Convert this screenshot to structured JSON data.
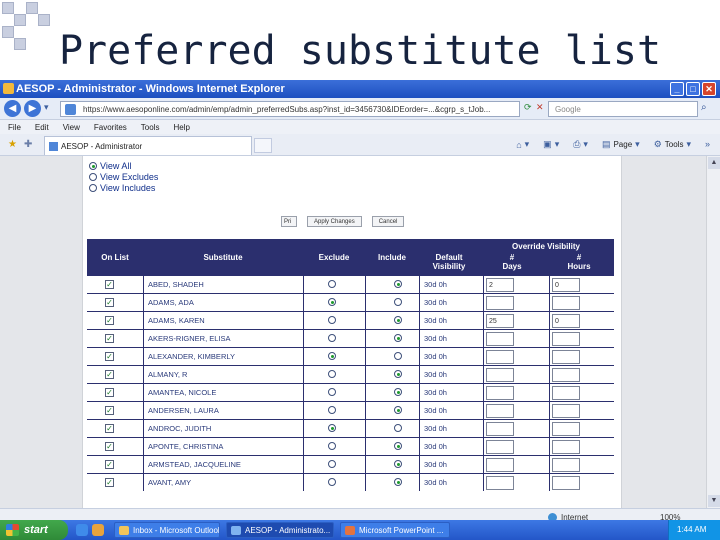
{
  "slide": {
    "title": "Preferred substitute list"
  },
  "window": {
    "title": "AESOP - Administrator - Windows Internet Explorer",
    "address": "https://www.aesoponline.com/admin/emp/admin_preferredSubs.asp?inst_id=3456730&IDEorder=...&cgrp_s_tJob...",
    "search_placeholder": "Google"
  },
  "menu": [
    "File",
    "Edit",
    "View",
    "Favorites",
    "Tools",
    "Help"
  ],
  "tab": {
    "label": "AESOP - Administrator"
  },
  "command_bar": {
    "page": "Page",
    "tools": "Tools"
  },
  "filters": [
    "View All",
    "View Excludes",
    "View Includes"
  ],
  "filter_selected": 0,
  "buttons": {
    "first": "Pri",
    "apply": "Apply Changes",
    "cancel": "Cancel"
  },
  "table": {
    "headers": {
      "on_list": "On List",
      "substitute": "Substitute",
      "exclude": "Exclude",
      "include": "Include",
      "default_visibility": "Default Visibility",
      "override_visibility": "Override Visibility",
      "days": "# Days",
      "hours": "# Hours"
    },
    "rows": [
      {
        "name": "ABED, SHADEH",
        "selection": "include",
        "default": "30d 0h",
        "days": "2",
        "hours": "0"
      },
      {
        "name": "ADAMS, ADA",
        "selection": "exclude",
        "default": "30d 0h",
        "days": "",
        "hours": ""
      },
      {
        "name": "ADAMS, KAREN",
        "selection": "include",
        "default": "30d 0h",
        "days": "25",
        "hours": "0"
      },
      {
        "name": "AKERS-RIGNER, ELISA",
        "selection": "include",
        "default": "30d 0h",
        "days": "",
        "hours": ""
      },
      {
        "name": "ALEXANDER, KIMBERLY",
        "selection": "exclude",
        "default": "30d 0h",
        "days": "",
        "hours": ""
      },
      {
        "name": "ALMANY, R",
        "selection": "include",
        "default": "30d 0h",
        "days": "",
        "hours": ""
      },
      {
        "name": "AMANTEA, NICOLE",
        "selection": "include",
        "default": "30d 0h",
        "days": "",
        "hours": ""
      },
      {
        "name": "ANDERSEN, LAURA",
        "selection": "include",
        "default": "30d 0h",
        "days": "",
        "hours": ""
      },
      {
        "name": "ANDROC, JUDITH",
        "selection": "exclude",
        "default": "30d 0h",
        "days": "",
        "hours": ""
      },
      {
        "name": "APONTE, CHRISTINA",
        "selection": "include",
        "default": "30d 0h",
        "days": "",
        "hours": ""
      },
      {
        "name": "ARMSTEAD, JACQUELINE",
        "selection": "include",
        "default": "30d 0h",
        "days": "",
        "hours": ""
      },
      {
        "name": "AVANT, AMY",
        "selection": "include",
        "default": "30d 0h",
        "days": "",
        "hours": ""
      }
    ]
  },
  "status": {
    "zone": "Internet",
    "zoom": "100%"
  },
  "taskbar": {
    "start": "start",
    "tasks": [
      "Inbox - Microsoft Outlook",
      "AESOP - Administrato...",
      "Microsoft PowerPoint ..."
    ],
    "clock": "1:44 AM"
  },
  "colors": {
    "header_bg": "#2b2f6e",
    "link_text": "#0f2e8a",
    "taskbar": "#2356c8",
    "start": "#2f8a38"
  }
}
